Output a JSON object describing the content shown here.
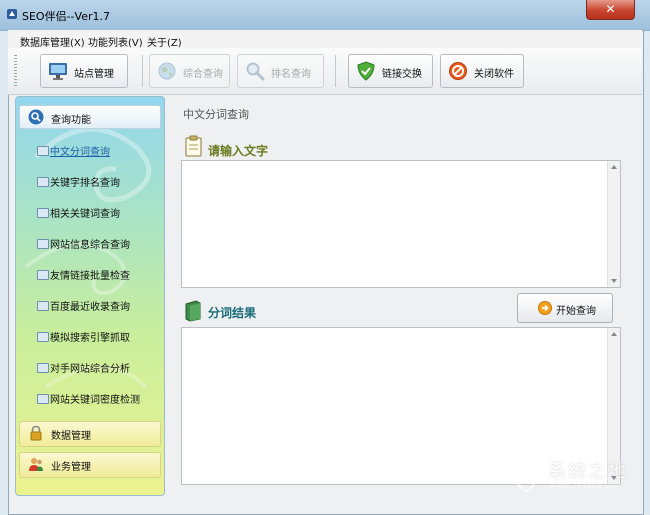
{
  "window": {
    "title": "SEO伴侣--Ver1.7",
    "close_label": "✕"
  },
  "menu": [
    "数据库管理(X)",
    "功能列表(V)",
    "关于(Z)"
  ],
  "toolbar": {
    "site_manage": "站点管理",
    "overall_query": "综合查询",
    "rank_query": "排名查询",
    "link_exchange": "链接交换",
    "close_software": "关闭软件"
  },
  "sidebar": {
    "query_header": "查询功能",
    "items": [
      "中文分词查询",
      "关键字排名查询",
      "相关关键词查询",
      "网站信息综合查询",
      "友情链接批量检查",
      "百度最近收录查询",
      "模拟搜索引擎抓取",
      "对手网站综合分析",
      "网站关键词密度检测"
    ],
    "data_manage": "数据管理",
    "business_manage": "业务管理"
  },
  "main": {
    "title": "中文分词查询",
    "input_title": "请输入文字",
    "result_title": "分词结果",
    "start_button": "开始查询",
    "input_text": "",
    "result_text": ""
  },
  "watermark": {
    "text": "系统之地",
    "url": "www.283868.com"
  },
  "colors": {
    "accent_blue": "#1d5fa8",
    "input_title": "#6b7a1f",
    "result_title": "#1a6c78"
  }
}
